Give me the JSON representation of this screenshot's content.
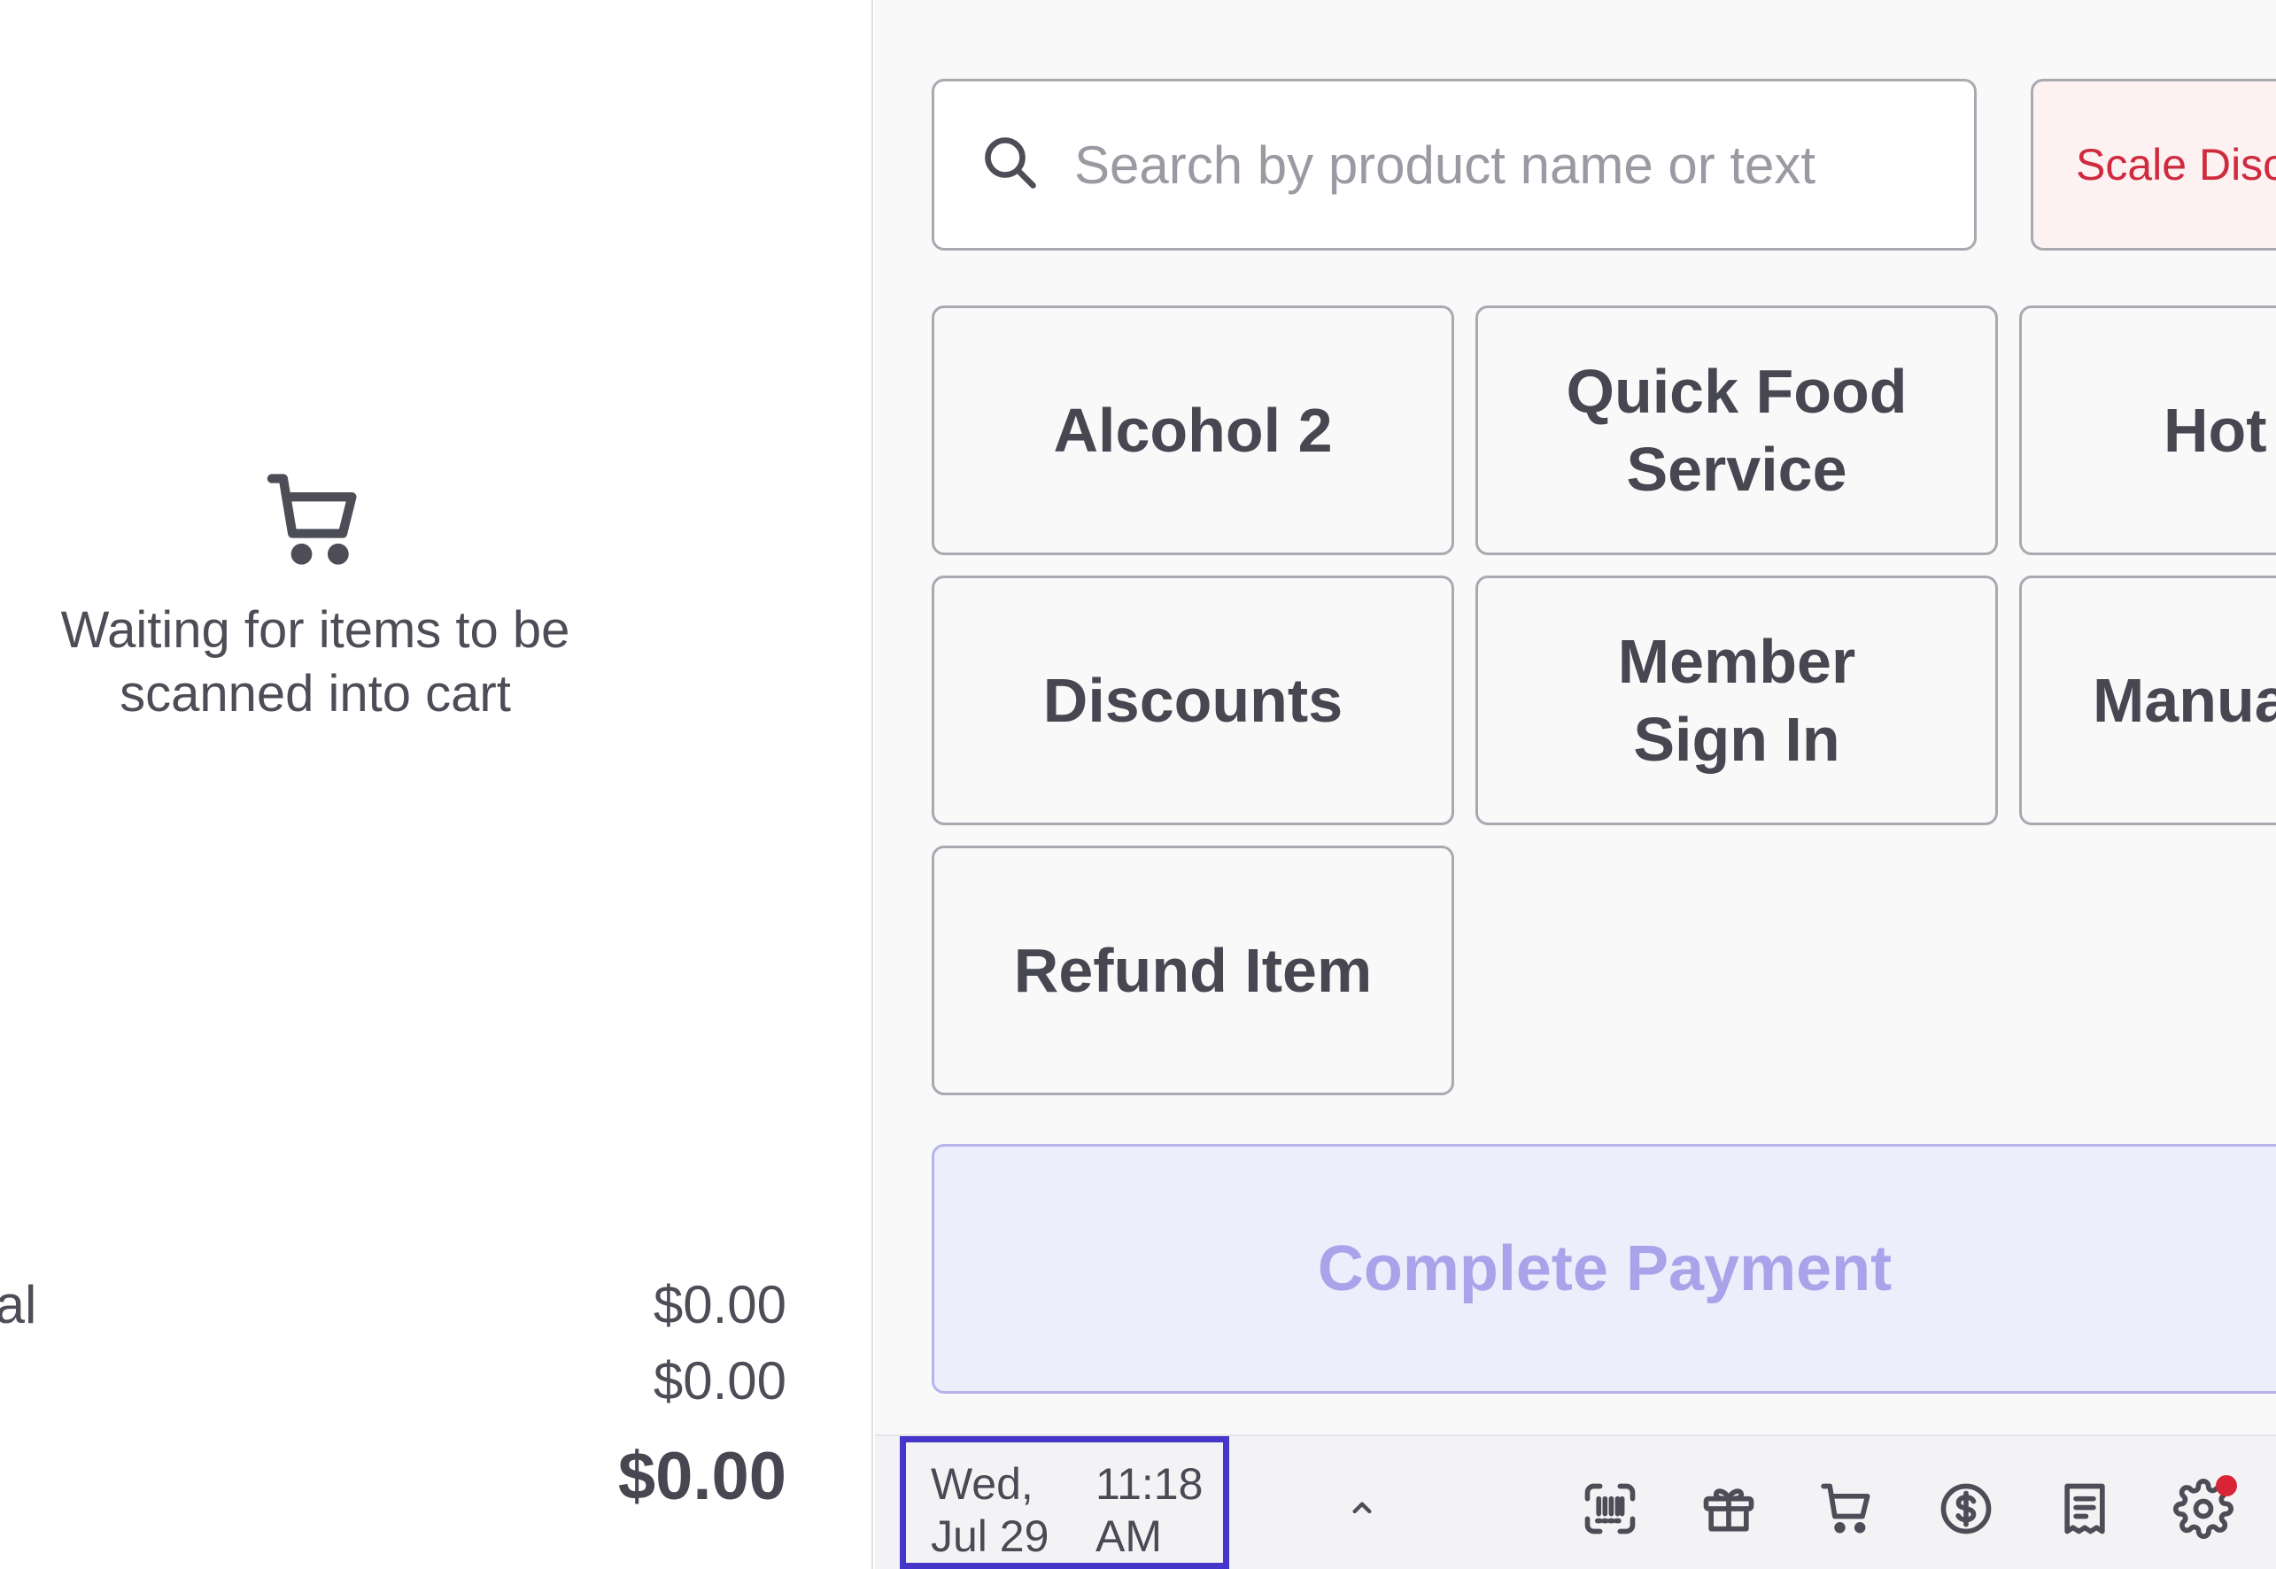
{
  "cart": {
    "empty_message": "Waiting for items to be scanned into cart",
    "empty_icon": "cart-icon",
    "totals": [
      {
        "label": "tal",
        "value": "$0.00"
      },
      {
        "label": "",
        "value": "$0.00"
      },
      {
        "label": "",
        "value": "$0.00"
      }
    ]
  },
  "search": {
    "placeholder": "Search by product name or text",
    "icon": "search-icon"
  },
  "scale_button": {
    "label": "Scale Disc"
  },
  "tiles": [
    {
      "label": "Alcohol 2"
    },
    {
      "label": "Quick Food\nService"
    },
    {
      "label": "Hot"
    },
    {
      "label": "Discounts"
    },
    {
      "label": "Member\nSign In"
    },
    {
      "label": "Manua"
    },
    {
      "label": "Refund Item"
    }
  ],
  "payment": {
    "label": "Complete Payment"
  },
  "status_bar": {
    "day": "Wed,",
    "date": "Jul 29",
    "time": "11:18",
    "ampm": "AM",
    "icons": [
      "barcode-scan-icon",
      "gift-icon",
      "cart-icon",
      "dollar-icon",
      "receipt-icon",
      "gear-icon"
    ],
    "notification_color": "#d92336"
  },
  "colors": {
    "accent": "#4537c9",
    "payment_bg": "#ededfb",
    "payment_text": "#a9a3ea",
    "scale_text": "#cf2b3f"
  }
}
